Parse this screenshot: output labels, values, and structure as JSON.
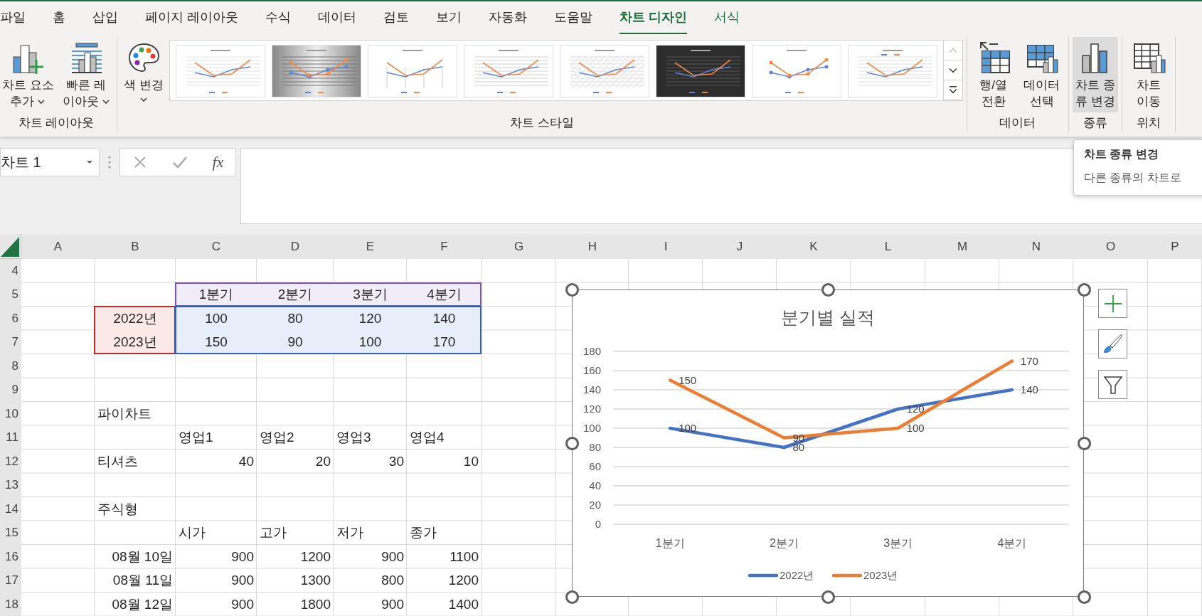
{
  "tabs": [
    {
      "label": "파일",
      "selected": false,
      "kind": "normal"
    },
    {
      "label": "홈",
      "selected": false,
      "kind": "normal"
    },
    {
      "label": "삽입",
      "selected": false,
      "kind": "normal"
    },
    {
      "label": "페이지 레이아웃",
      "selected": false,
      "kind": "normal"
    },
    {
      "label": "수식",
      "selected": false,
      "kind": "normal"
    },
    {
      "label": "데이터",
      "selected": false,
      "kind": "normal"
    },
    {
      "label": "검토",
      "selected": false,
      "kind": "normal"
    },
    {
      "label": "보기",
      "selected": false,
      "kind": "normal"
    },
    {
      "label": "자동화",
      "selected": false,
      "kind": "normal"
    },
    {
      "label": "도움말",
      "selected": false,
      "kind": "normal"
    },
    {
      "label": "차트 디자인",
      "selected": true,
      "kind": "contextual"
    },
    {
      "label": "서식",
      "selected": false,
      "kind": "contextual"
    }
  ],
  "ribbon": {
    "groups": [
      {
        "label": "차트 레이아웃",
        "buttons": [
          {
            "label": "차트 요소\n추가",
            "has_menu": true,
            "highlighted": false
          },
          {
            "label": "빠른 레\n이아웃",
            "has_menu": true,
            "highlighted": false
          }
        ]
      },
      {
        "label": "차트 스타일",
        "buttons": [
          {
            "label": "색 변경",
            "has_menu": true,
            "highlighted": false
          }
        ],
        "gallery": [
          {
            "kind": "light"
          },
          {
            "kind": "gradient"
          },
          {
            "kind": "droplines"
          },
          {
            "kind": "bold"
          },
          {
            "kind": "hatched"
          },
          {
            "kind": "dark"
          },
          {
            "kind": "minimal"
          },
          {
            "kind": "legend-top"
          }
        ]
      },
      {
        "label": "데이터",
        "buttons": [
          {
            "label": "행/열\n전환",
            "has_menu": false,
            "highlighted": false
          },
          {
            "label": "데이터\n선택",
            "has_menu": false,
            "highlighted": false
          }
        ]
      },
      {
        "label": "종류",
        "buttons": [
          {
            "label": "차트 종\n류 변경",
            "has_menu": false,
            "highlighted": true
          }
        ]
      },
      {
        "label": "위치",
        "buttons": [
          {
            "label": "차트\n이동",
            "has_menu": false,
            "highlighted": false
          }
        ]
      }
    ]
  },
  "formula_bar": {
    "name_box": "차트 1",
    "function_label": "fx"
  },
  "tooltip": {
    "title": "차트 종류 변경",
    "text": "다른 종류의 차트로"
  },
  "sheet": {
    "columns": [
      "A",
      "B",
      "C",
      "D",
      "E",
      "F",
      "G",
      "H",
      "I",
      "J",
      "K",
      "L",
      "M",
      "N",
      "O",
      "P"
    ],
    "rows": [
      {
        "label": "4",
        "cells": []
      },
      {
        "label": "5",
        "cells": [
          "",
          "",
          {
            "text": "1분기",
            "kind": "category"
          },
          {
            "text": "2분기",
            "kind": "category"
          },
          {
            "text": "3분기",
            "kind": "category"
          },
          {
            "text": "4분기",
            "kind": "category"
          }
        ]
      },
      {
        "label": "6",
        "cells": [
          "",
          {
            "text": "2022년",
            "kind": "series"
          },
          {
            "text": "100",
            "kind": "value"
          },
          {
            "text": "80",
            "kind": "value"
          },
          {
            "text": "120",
            "kind": "value"
          },
          {
            "text": "140",
            "kind": "value"
          }
        ]
      },
      {
        "label": "7",
        "cells": [
          "",
          {
            "text": "2023년",
            "kind": "series"
          },
          {
            "text": "150",
            "kind": "value"
          },
          {
            "text": "90",
            "kind": "value"
          },
          {
            "text": "100",
            "kind": "value"
          },
          {
            "text": "170",
            "kind": "value"
          }
        ]
      },
      {
        "label": "8",
        "cells": []
      },
      {
        "label": "9",
        "cells": []
      },
      {
        "label": "10",
        "cells": [
          "",
          {
            "text": "파이차트",
            "kind": "text"
          }
        ]
      },
      {
        "label": "11",
        "cells": [
          "",
          "",
          {
            "text": "영업1",
            "kind": "text"
          },
          {
            "text": "영업2",
            "kind": "text"
          },
          {
            "text": "영업3",
            "kind": "text"
          },
          {
            "text": "영업4",
            "kind": "text"
          }
        ]
      },
      {
        "label": "12",
        "cells": [
          "",
          {
            "text": "티셔츠",
            "kind": "text"
          },
          {
            "text": "40",
            "kind": "number"
          },
          {
            "text": "20",
            "kind": "number"
          },
          {
            "text": "30",
            "kind": "number"
          },
          {
            "text": "10",
            "kind": "number"
          }
        ]
      },
      {
        "label": "13",
        "cells": []
      },
      {
        "label": "14",
        "cells": [
          "",
          {
            "text": "주식형",
            "kind": "text"
          }
        ]
      },
      {
        "label": "15",
        "cells": [
          "",
          "",
          {
            "text": "시가",
            "kind": "text"
          },
          {
            "text": "고가",
            "kind": "text"
          },
          {
            "text": "저가",
            "kind": "text"
          },
          {
            "text": "종가",
            "kind": "text"
          }
        ]
      },
      {
        "label": "16",
        "cells": [
          "",
          {
            "text": "08월 10일",
            "kind": "number"
          },
          {
            "text": "900",
            "kind": "number"
          },
          {
            "text": "1200",
            "kind": "number"
          },
          {
            "text": "900",
            "kind": "number"
          },
          {
            "text": "1100",
            "kind": "number"
          }
        ]
      },
      {
        "label": "17",
        "cells": [
          "",
          {
            "text": "08월 11일",
            "kind": "number"
          },
          {
            "text": "900",
            "kind": "number"
          },
          {
            "text": "1300",
            "kind": "number"
          },
          {
            "text": "800",
            "kind": "number"
          },
          {
            "text": "1200",
            "kind": "number"
          }
        ]
      },
      {
        "label": "18",
        "cells": [
          "",
          {
            "text": "08월 12일",
            "kind": "number"
          },
          {
            "text": "900",
            "kind": "number"
          },
          {
            "text": "1800",
            "kind": "number"
          },
          {
            "text": "900",
            "kind": "number"
          },
          {
            "text": "1400",
            "kind": "number"
          }
        ]
      }
    ]
  },
  "chart": {
    "chart_data": {
      "type": "line",
      "title": "분기별 실적",
      "categories": [
        "1분기",
        "2분기",
        "3분기",
        "4분기"
      ],
      "series": [
        {
          "name": "2022년",
          "color": "#4472c4",
          "values": [
            100,
            80,
            120,
            140
          ]
        },
        {
          "name": "2023년",
          "color": "#ed7d31",
          "values": [
            150,
            90,
            100,
            170
          ]
        }
      ],
      "ylim": [
        0,
        180
      ],
      "yticks": [
        0,
        20,
        40,
        60,
        80,
        100,
        120,
        140,
        160,
        180
      ],
      "grid": true,
      "legend": true,
      "data_labels": true
    }
  }
}
